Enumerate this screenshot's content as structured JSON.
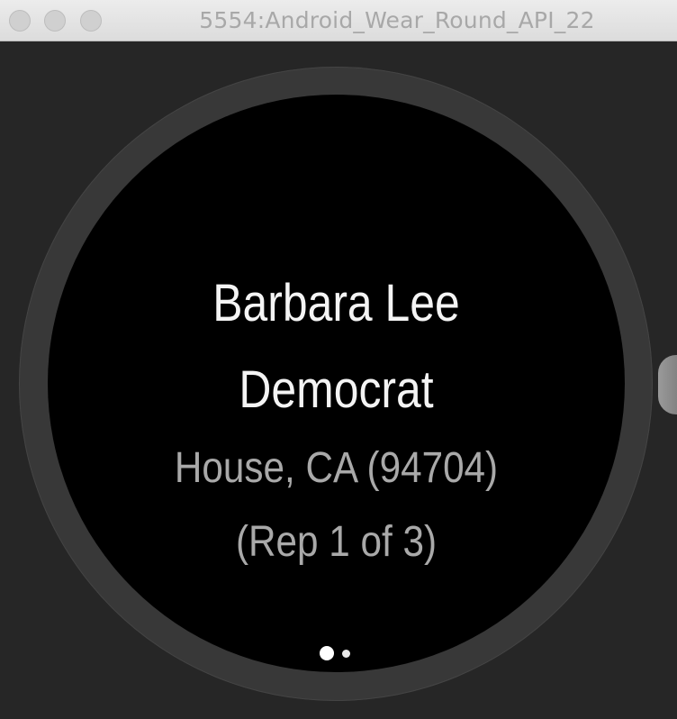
{
  "window": {
    "title": "5554:Android_Wear_Round_API_22"
  },
  "card": {
    "name": "Barbara Lee",
    "party": "Democrat",
    "district": "House, CA (94704)",
    "position": "(Rep 1 of 3)"
  },
  "pager": {
    "current_page": 1,
    "total_pages": 2
  },
  "colors": {
    "screen_background": "#000000",
    "primary_text": "#f4f4f4",
    "secondary_text": "#a9a9a9",
    "bezel": "#383838"
  }
}
